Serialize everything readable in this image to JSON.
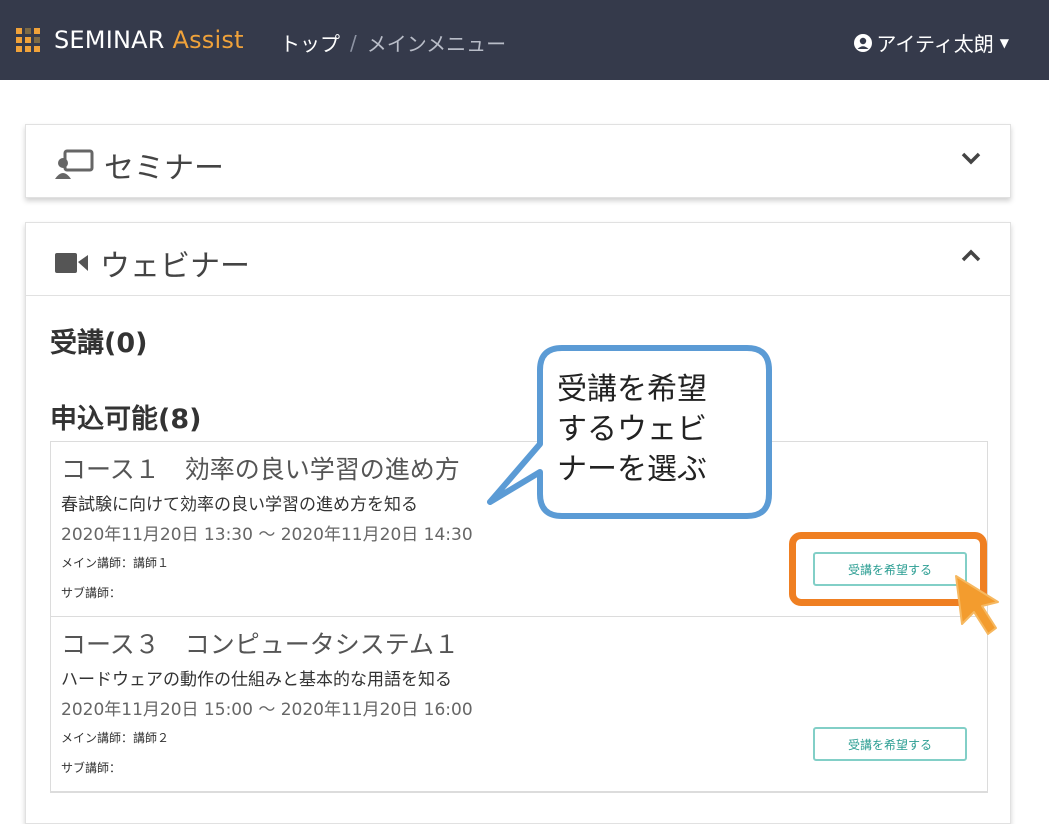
{
  "header": {
    "brand_main": "SEMINAR",
    "brand_accent": "Assist",
    "breadcrumb_home": "トップ",
    "breadcrumb_sep": "/",
    "breadcrumb_current": "メインメニュー",
    "user_name": "アイティ太朗"
  },
  "seminar_panel": {
    "title": "セミナー"
  },
  "webinar_panel": {
    "title": "ウェビナー",
    "enrolled_heading": "受講(0)",
    "available_heading": "申込可能(8)",
    "courses": [
      {
        "title": "コース１　効率の良い学習の進め方",
        "description": "春試験に向けて効率の良い学習の進め方を知る",
        "datetime": "2020年11月20日 13:30 〜 2020年11月20日 14:30",
        "main_lecturer": "メイン講師：講師１",
        "sub_lecturer": "サブ講師：",
        "apply_label": "受講を希望する"
      },
      {
        "title": "コース３　コンピュータシステム１",
        "description": "ハードウェアの動作の仕組みと基本的な用語を知る",
        "datetime": "2020年11月20日 15:00 〜 2020年11月20日 16:00",
        "main_lecturer": "メイン講師：講師２",
        "sub_lecturer": "サブ講師：",
        "apply_label": "受講を希望する"
      }
    ]
  },
  "callout": {
    "line1": "受講を希望",
    "line2": "するウェビ",
    "line3": "ナーを選ぶ"
  },
  "colors": {
    "navbar": "#353a4b",
    "brand_accent": "#f0a23a",
    "button_border": "#82cfc7",
    "highlight": "#ef7f22",
    "callout_border": "#5b9bd5"
  }
}
